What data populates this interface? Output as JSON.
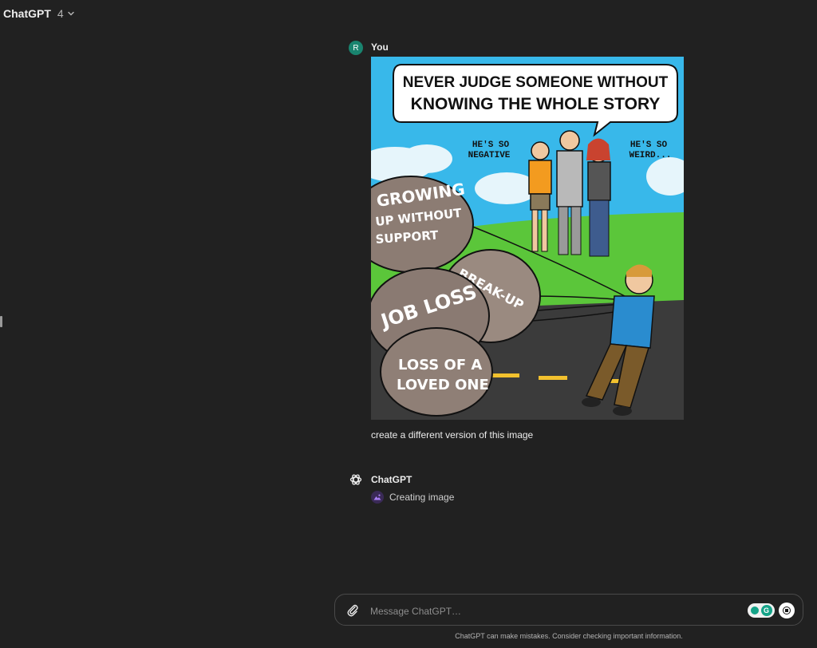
{
  "header": {
    "model_name": "ChatGPT",
    "model_version": "4"
  },
  "conversation": {
    "user_message": {
      "author": "You",
      "avatar_initial": "R",
      "text": "create a different version of this image",
      "image": {
        "caption": "NEVER JUDGE SOMEONE WITHOUT",
        "caption_line2_a": "KNOWING",
        "caption_line2_b": "THE WHOLE STORY",
        "speech_left_1": "HE'S SO",
        "speech_left_2": "NEGATIVE",
        "speech_right_1": "HE'S SO",
        "speech_right_2": "WEIRD...",
        "rock_1a": "GROWING",
        "rock_1b": "UP WITHOUT",
        "rock_1c": "SUPPORT",
        "rock_2": "BREAK-UP",
        "rock_3": "JOB LOSS",
        "rock_4a": "LOSS OF A",
        "rock_4b": "LOVED ONE"
      }
    },
    "assistant_message": {
      "author": "ChatGPT",
      "status_text": "Creating image"
    }
  },
  "composer": {
    "placeholder": "Message ChatGPT…"
  },
  "footer": {
    "disclaimer": "ChatGPT can make mistakes. Consider checking important information."
  },
  "colors": {
    "background": "#212121",
    "avatar": "#19846f",
    "status_icon": "#a97ef5"
  },
  "icons": {
    "model_dropdown": "chevron-down-icon",
    "chatgpt_logo": "openai-logo-icon",
    "status": "image-generation-icon",
    "attach": "paperclip-icon",
    "stop": "stop-icon",
    "grammarly": "grammarly-icon"
  }
}
